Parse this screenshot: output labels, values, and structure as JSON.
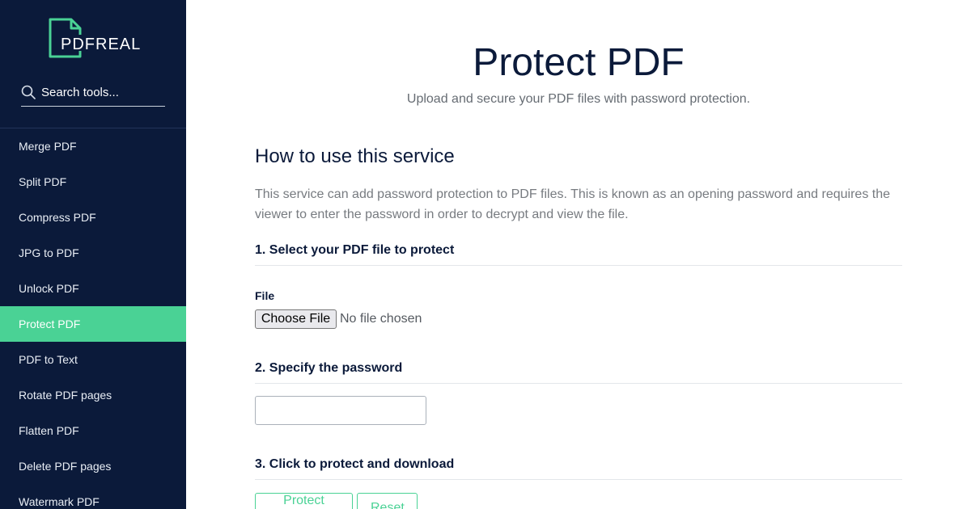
{
  "sidebar": {
    "logo_text": "PDFREAL",
    "search_placeholder": "Search tools...",
    "items": [
      {
        "label": "Merge PDF",
        "active": false
      },
      {
        "label": "Split PDF",
        "active": false
      },
      {
        "label": "Compress PDF",
        "active": false
      },
      {
        "label": "JPG to PDF",
        "active": false
      },
      {
        "label": "Unlock PDF",
        "active": false
      },
      {
        "label": "Protect PDF",
        "active": true
      },
      {
        "label": "PDF to Text",
        "active": false
      },
      {
        "label": "Rotate PDF pages",
        "active": false
      },
      {
        "label": "Flatten PDF",
        "active": false
      },
      {
        "label": "Delete PDF pages",
        "active": false
      },
      {
        "label": "Watermark PDF",
        "active": false
      }
    ]
  },
  "main": {
    "title": "Protect PDF",
    "subtitle": "Upload and secure your PDF files with password protection.",
    "how_title": "How to use this service",
    "how_text": "This service can add password protection to PDF files. This is known as an opening password and requires the viewer to enter the password in order to decrypt and view the file.",
    "step1": "1. Select your PDF file to protect",
    "file_label": "File",
    "choose_file_label": "Choose File",
    "file_status": "No file chosen",
    "step2": "2. Specify the password",
    "password_value": "",
    "step3": "3. Click to protect and download",
    "protect_label": "Protect PDF",
    "reset_label": "Reset"
  },
  "colors": {
    "sidebar_bg": "#0b1a3a",
    "accent": "#4ad295",
    "heading": "#0b1a3a"
  },
  "icons": {
    "logo": "document-outline-icon",
    "search": "search-icon"
  }
}
